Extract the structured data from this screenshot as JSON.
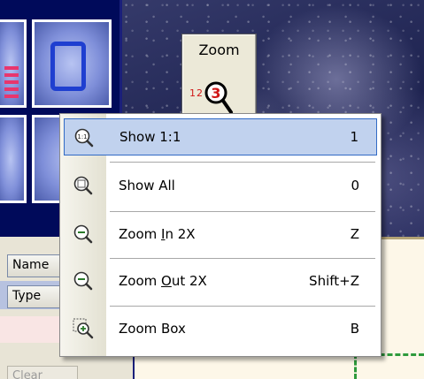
{
  "toolbar": {
    "zoom_tool_label": "Zoom",
    "zoom_tool_digits": "12"
  },
  "properties": {
    "name_label": "Name",
    "type_label": "Type",
    "clear_label": "Clear"
  },
  "context_menu": {
    "items": [
      {
        "label": "Show 1:1",
        "shortcut": "1",
        "icon": "zoom-1to1-icon",
        "selected": true
      },
      {
        "label": "Show All",
        "shortcut": "0",
        "icon": "zoom-all-icon",
        "selected": false
      },
      {
        "label_prefix": "Zoom ",
        "label_mnemonic": "I",
        "label_suffix": "n 2X",
        "shortcut": "Z",
        "icon": "zoom-in-icon",
        "selected": false
      },
      {
        "label_prefix": "Zoom ",
        "label_mnemonic": "O",
        "label_suffix": "ut 2X",
        "shortcut": "Shift+Z",
        "icon": "zoom-out-icon",
        "selected": false
      },
      {
        "label": "Zoom Box",
        "shortcut": "B",
        "icon": "zoom-box-icon",
        "selected": false
      }
    ]
  },
  "colors": {
    "menu_highlight": "#c1d2ee",
    "menu_highlight_border": "#316ac5",
    "zoom_digit_red": "#d01818",
    "selection_dash": "#2e9a3c"
  }
}
